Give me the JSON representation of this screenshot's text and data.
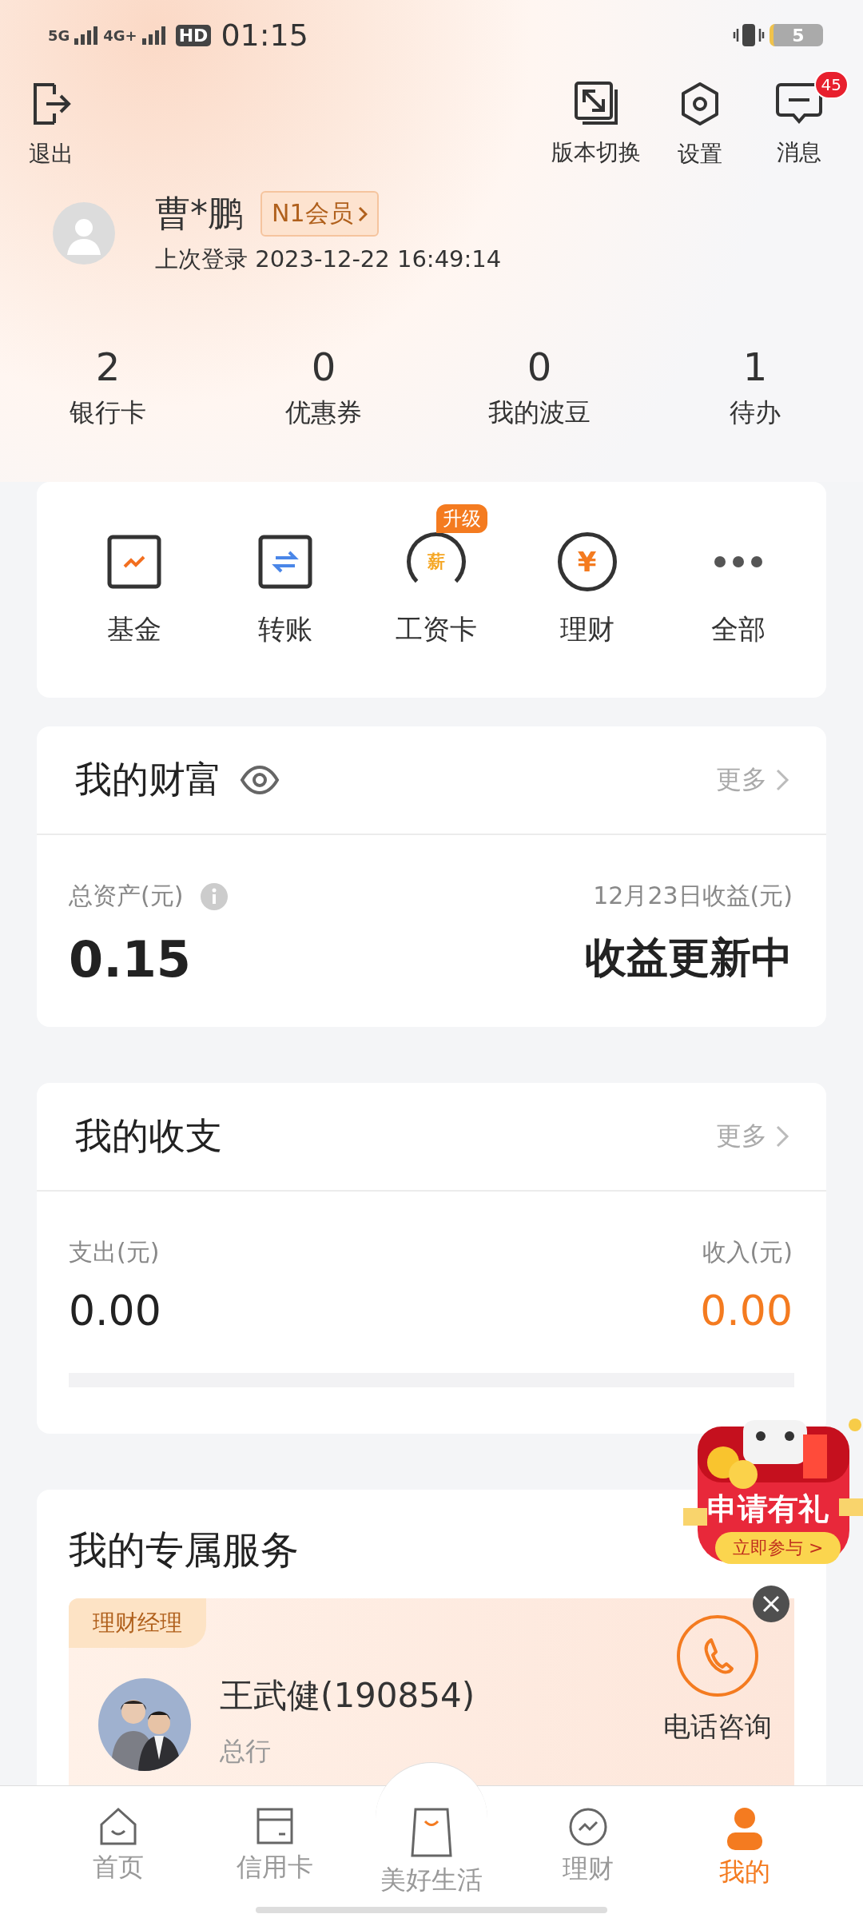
{
  "status_bar": {
    "network_1": "5G",
    "network_2": "4G+",
    "hd": "HD",
    "time": "01:15",
    "battery": "5"
  },
  "left_action": {
    "label": "退出",
    "kind": "logout"
  },
  "right_actions": [
    {
      "label": "版本切换",
      "kind": "switch"
    },
    {
      "label": "设置",
      "kind": "settings"
    },
    {
      "label": "消息",
      "kind": "message",
      "badge": "45"
    }
  ],
  "profile": {
    "name": "曹*鹏",
    "member_badge": "N1会员",
    "last_login": "上次登录 2023-12-22 16:49:14"
  },
  "stats": [
    {
      "value": "2",
      "label": "银行卡"
    },
    {
      "value": "0",
      "label": "优惠券"
    },
    {
      "value": "0",
      "label": "我的波豆"
    },
    {
      "value": "1",
      "label": "待办"
    }
  ],
  "shortcuts": [
    {
      "label": "基金",
      "kind": "fund"
    },
    {
      "label": "转账",
      "kind": "transfer"
    },
    {
      "label": "工资卡",
      "kind": "salary",
      "icon_text": "薪",
      "badge": "升级"
    },
    {
      "label": "理财",
      "kind": "wealth",
      "icon_text": "¥"
    },
    {
      "label": "全部",
      "kind": "more"
    }
  ],
  "wealth": {
    "title": "我的财富",
    "more": "更多",
    "total_label": "总资产(元)",
    "total_value": "0.15",
    "income_label": "12月23日收益(元)",
    "income_value": "收益更新中"
  },
  "cashflow": {
    "title": "我的收支",
    "more": "更多",
    "expense_label": "支出(元)",
    "expense_value": "0.00",
    "income_label": "收入(元)",
    "income_value": "0.00"
  },
  "services": {
    "title": "我的专属服务",
    "tag": "理财经理",
    "manager_name": "王武健(190854)",
    "branch": "总行",
    "call_label": "电话咨询"
  },
  "promo": {
    "title": "申请有礼",
    "button": "立即参与 >"
  },
  "tab_bar": [
    {
      "label": "首页",
      "kind": "home",
      "selected": false
    },
    {
      "label": "信用卡",
      "kind": "card",
      "selected": false
    },
    {
      "label": "美好生活",
      "kind": "bag",
      "selected": false
    },
    {
      "label": "理财",
      "kind": "chart",
      "selected": false
    },
    {
      "label": "我的",
      "kind": "person",
      "selected": true
    }
  ]
}
